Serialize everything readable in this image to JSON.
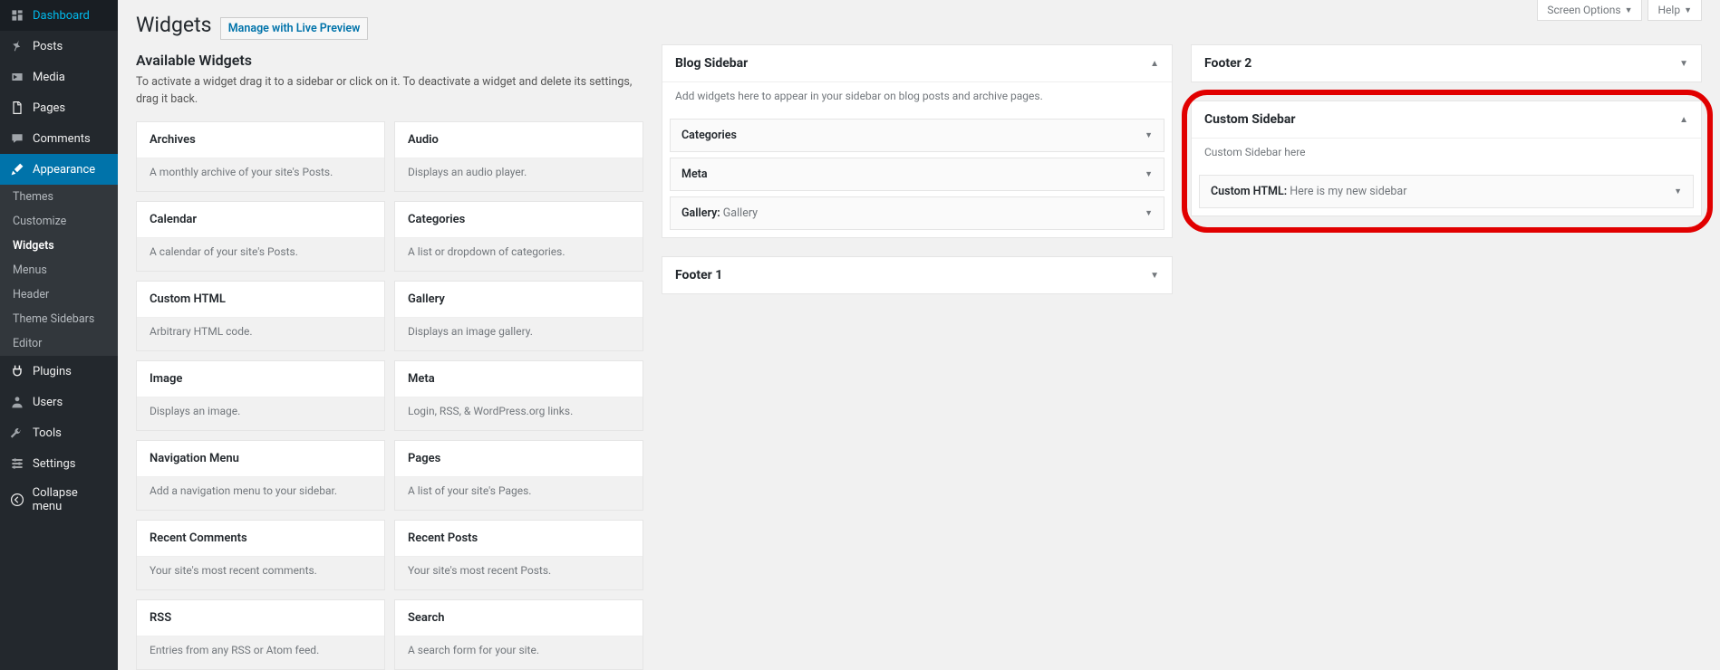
{
  "top_tabs": {
    "screen_options": "Screen Options",
    "help": "Help"
  },
  "sidebar_menu": [
    {
      "id": "dashboard",
      "label": "Dashboard",
      "icon": "dashboard"
    },
    {
      "id": "posts",
      "label": "Posts",
      "icon": "pin"
    },
    {
      "id": "media",
      "label": "Media",
      "icon": "media"
    },
    {
      "id": "pages",
      "label": "Pages",
      "icon": "page"
    },
    {
      "id": "comments",
      "label": "Comments",
      "icon": "comment"
    },
    {
      "id": "appearance",
      "label": "Appearance",
      "icon": "brush",
      "current": true,
      "submenu": [
        {
          "id": "themes",
          "label": "Themes"
        },
        {
          "id": "customize",
          "label": "Customize"
        },
        {
          "id": "widgets",
          "label": "Widgets",
          "current": true
        },
        {
          "id": "menus",
          "label": "Menus"
        },
        {
          "id": "header",
          "label": "Header"
        },
        {
          "id": "theme-sidebars",
          "label": "Theme Sidebars"
        },
        {
          "id": "editor",
          "label": "Editor"
        }
      ]
    },
    {
      "id": "plugins",
      "label": "Plugins",
      "icon": "plug"
    },
    {
      "id": "users",
      "label": "Users",
      "icon": "user"
    },
    {
      "id": "tools",
      "label": "Tools",
      "icon": "wrench"
    },
    {
      "id": "settings",
      "label": "Settings",
      "icon": "sliders"
    },
    {
      "id": "collapse",
      "label": "Collapse menu",
      "icon": "collapse"
    }
  ],
  "page": {
    "title": "Widgets",
    "action_label": "Manage with Live Preview",
    "available_title": "Available Widgets",
    "available_desc": "To activate a widget drag it to a sidebar or click on it. To deactivate a widget and delete its settings, drag it back."
  },
  "available_widgets": [
    {
      "name": "Archives",
      "desc": "A monthly archive of your site's Posts."
    },
    {
      "name": "Audio",
      "desc": "Displays an audio player."
    },
    {
      "name": "Calendar",
      "desc": "A calendar of your site's Posts."
    },
    {
      "name": "Categories",
      "desc": "A list or dropdown of categories."
    },
    {
      "name": "Custom HTML",
      "desc": "Arbitrary HTML code."
    },
    {
      "name": "Gallery",
      "desc": "Displays an image gallery."
    },
    {
      "name": "Image",
      "desc": "Displays an image."
    },
    {
      "name": "Meta",
      "desc": "Login, RSS, & WordPress.org links."
    },
    {
      "name": "Navigation Menu",
      "desc": "Add a navigation menu to your sidebar."
    },
    {
      "name": "Pages",
      "desc": "A list of your site's Pages."
    },
    {
      "name": "Recent Comments",
      "desc": "Your site's most recent comments."
    },
    {
      "name": "Recent Posts",
      "desc": "Your site's most recent Posts."
    },
    {
      "name": "RSS",
      "desc": "Entries from any RSS or Atom feed."
    },
    {
      "name": "Search",
      "desc": "A search form for your site."
    }
  ],
  "widget_areas": {
    "col1": [
      {
        "id": "blog-sidebar",
        "title": "Blog Sidebar",
        "expanded": true,
        "desc": "Add widgets here to appear in your sidebar on blog posts and archive pages.",
        "widgets": [
          {
            "type": "Categories",
            "sub": ""
          },
          {
            "type": "Meta",
            "sub": ""
          },
          {
            "type": "Gallery",
            "sub": "Gallery"
          }
        ]
      },
      {
        "id": "footer-1",
        "title": "Footer 1",
        "expanded": false
      }
    ],
    "col2": [
      {
        "id": "footer-2",
        "title": "Footer 2",
        "expanded": false
      },
      {
        "id": "custom-sidebar",
        "title": "Custom Sidebar",
        "expanded": true,
        "desc": "Custom Sidebar here",
        "widgets": [
          {
            "type": "Custom HTML",
            "sub": "Here is my new sidebar"
          }
        ],
        "highlighted": true
      }
    ]
  }
}
